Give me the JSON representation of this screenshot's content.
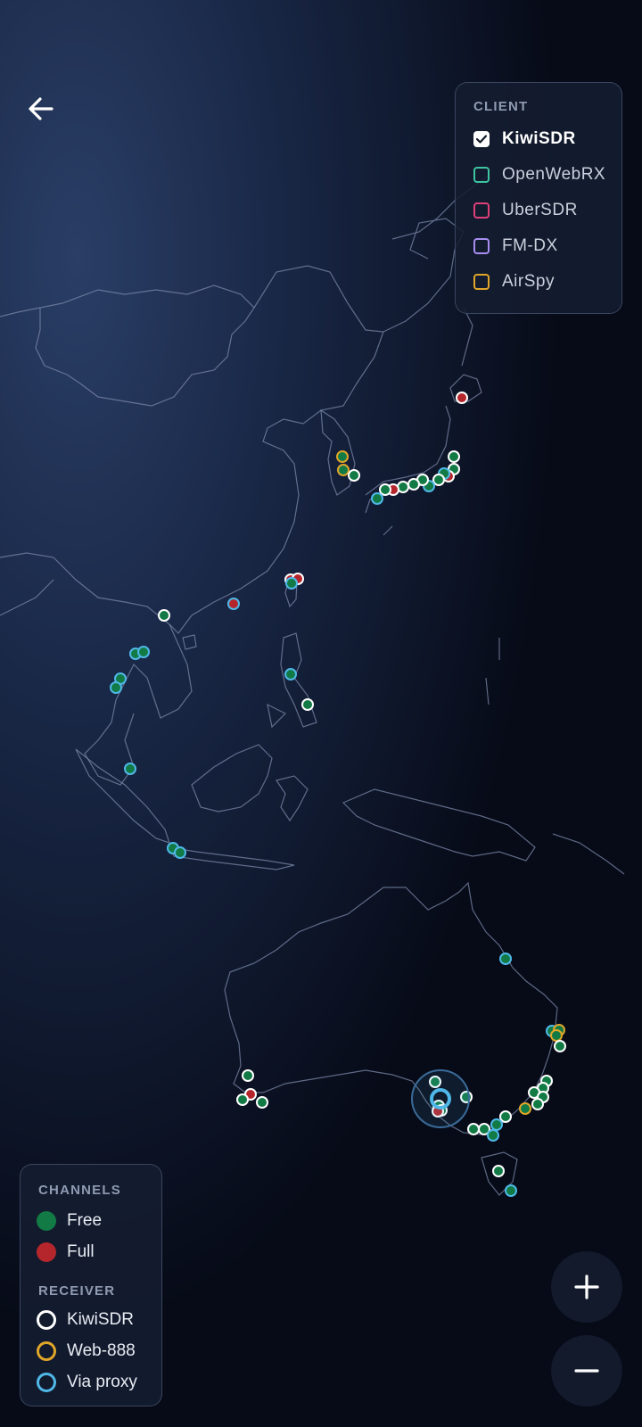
{
  "colors": {
    "free": "#127a45",
    "full": "#b5262c",
    "kiwisdr": "#ffffff",
    "web888": "#e0a62a",
    "proxy": "#4fb8e8",
    "openwebrx": "#3ec4a0",
    "ubersdr": "#e0407a",
    "fmdx": "#a98ef2",
    "airspy": "#e0a62a"
  },
  "client": {
    "title": "CLIENT",
    "items": [
      {
        "label": "KiwiSDR",
        "checked": true,
        "color": "#ffffff"
      },
      {
        "label": "OpenWebRX",
        "checked": false,
        "color": "#3ec4a0"
      },
      {
        "label": "UberSDR",
        "checked": false,
        "color": "#e0407a"
      },
      {
        "label": "FM-DX",
        "checked": false,
        "color": "#a98ef2"
      },
      {
        "label": "AirSpy",
        "checked": false,
        "color": "#e0a62a"
      }
    ]
  },
  "legend": {
    "channels_title": "CHANNELS",
    "free_label": "Free",
    "full_label": "Full",
    "receiver_title": "RECEIVER",
    "kiwisdr_label": "KiwiSDR",
    "web888_label": "Web-888",
    "proxy_label": "Via proxy"
  },
  "icons": {
    "back": "arrow-left-icon",
    "zoom_in": "plus-icon",
    "zoom_out": "minus-icon",
    "checkmark": "checkmark-icon"
  }
}
